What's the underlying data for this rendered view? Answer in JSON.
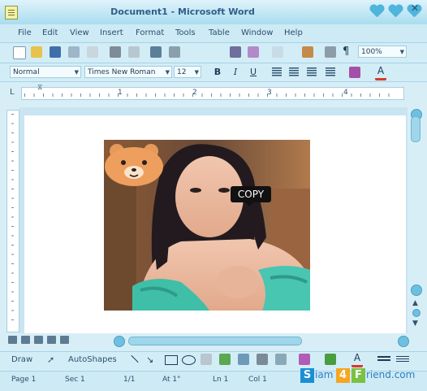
{
  "window": {
    "title": "Document1 - Microsoft Word"
  },
  "menu": {
    "items": [
      "File",
      "Edit",
      "View",
      "Insert",
      "Format",
      "Tools",
      "Table",
      "Window",
      "Help"
    ]
  },
  "toolbar": {
    "zoom": "100%",
    "style": "Normal",
    "font": "Times New Roman",
    "font_size": "12",
    "bold_label": "B",
    "italic_label": "I",
    "underline_label": "U",
    "paragraph_mark": "¶"
  },
  "ruler": {
    "numbers": [
      "1",
      "2",
      "3",
      "4"
    ]
  },
  "document": {
    "photo_sticker_text": "COPY"
  },
  "drawbar": {
    "draw_label": "Draw",
    "autoshapes_label": "AutoShapes"
  },
  "status": {
    "page": "Page 1",
    "section": "Sec 1",
    "pages": "1/1",
    "at": "At 1\"",
    "line": "Ln 1",
    "col": "Col 1"
  },
  "watermark": {
    "letters": [
      "S",
      "4",
      "F"
    ],
    "text_1": "iam",
    "text_2": "riend.com",
    "colors": [
      "#1a8fd6",
      "#f5a623",
      "#7ac142"
    ]
  },
  "colors": {
    "title_text": "#2f5f86",
    "accent": "#4fb5dc",
    "frame": "#d8eef7"
  }
}
